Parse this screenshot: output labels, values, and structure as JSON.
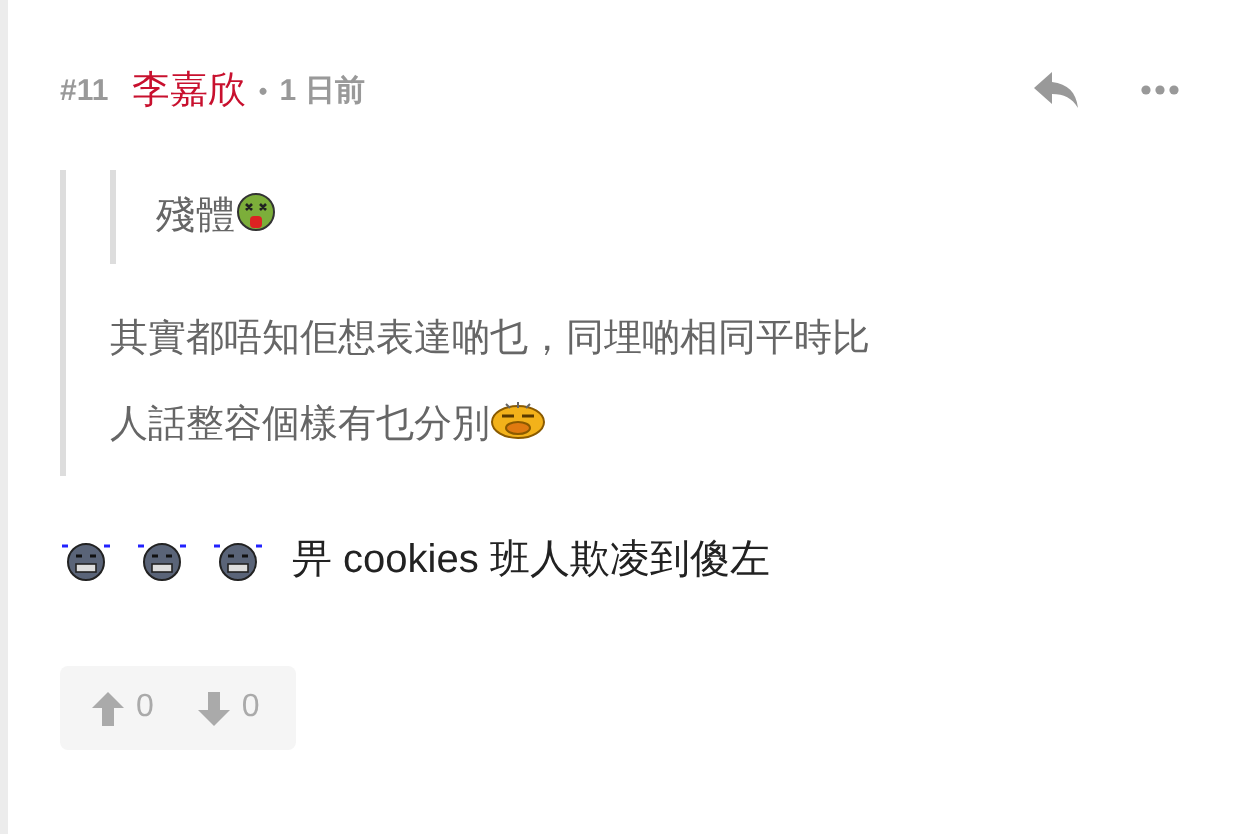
{
  "post": {
    "number": "#11",
    "author": "李嘉欣",
    "separator": "•",
    "time": "1 日前",
    "quote": {
      "nested_quote": {
        "text": "殘體"
      },
      "lines": [
        "其實都唔知佢想表達啲乜，同埋啲相同平時比",
        "人話整容個樣有乜分別"
      ]
    },
    "body": "畀 cookies 班人欺凌到傻左",
    "votes": {
      "up": "0",
      "down": "0"
    }
  }
}
